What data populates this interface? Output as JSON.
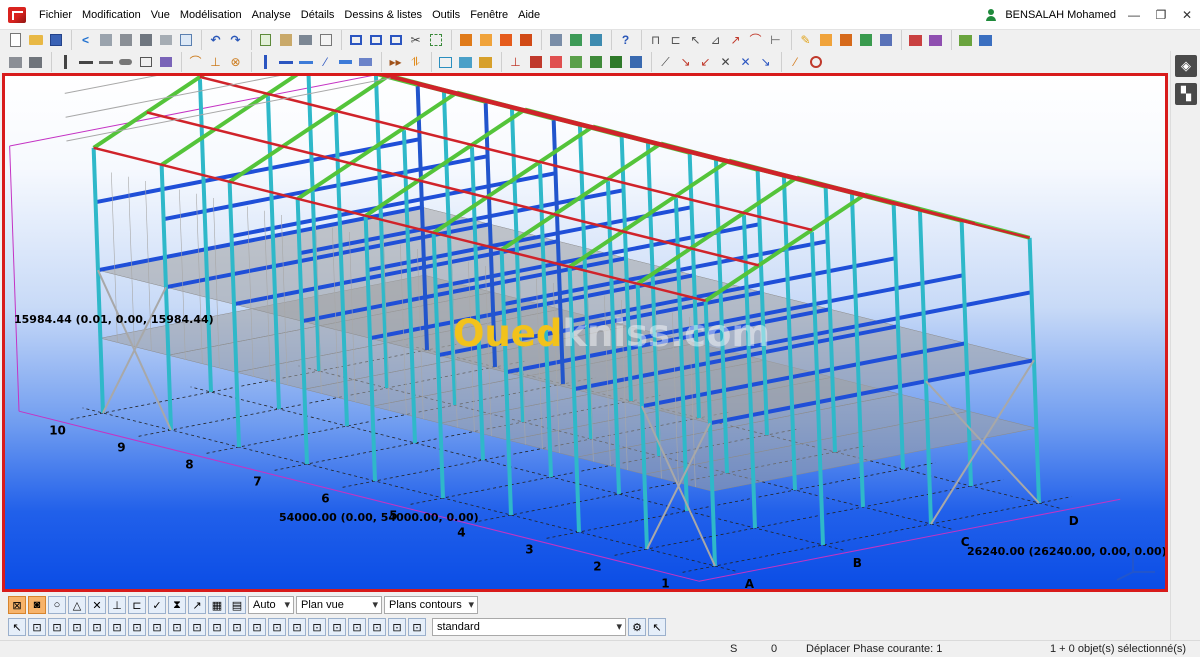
{
  "menu": {
    "items": [
      "Fichier",
      "Modification",
      "Vue",
      "Modélisation",
      "Analyse",
      "Détails",
      "Dessins & listes",
      "Outils",
      "Fenêtre",
      "Aide"
    ]
  },
  "user": {
    "name": "BENSALAH Mohamed"
  },
  "window_controls": {
    "minimize": "—",
    "restore": "❐",
    "close": "✕"
  },
  "viewport": {
    "watermark": {
      "part1": "Oued",
      "part2": "kniss.com"
    },
    "dimensions": {
      "height": "15984.44 (0.01, 0.00, 15984.44)",
      "length": "54000.00 (0.00, 54000.00, 0.00)",
      "width": "26240.00 (26240.00, 0.00, 0.00)"
    },
    "grid_labels_front": [
      "1",
      "2",
      "3",
      "4",
      "5",
      "6",
      "7",
      "8",
      "9",
      "10"
    ],
    "grid_labels_side": [
      "A",
      "B",
      "C",
      "D"
    ],
    "colors": {
      "purlins": "#d0232a",
      "rafters": "#54c43a",
      "columns": "#2fb8c9",
      "beams": "#1f4fd8",
      "slab": "#a0a0a0",
      "frame": "#a8a8a8"
    }
  },
  "bottom_toolbar": {
    "selects": {
      "auto": "Auto",
      "view": "Plan vue",
      "contours": "Plans contours"
    },
    "filter": "standard"
  },
  "statusbar": {
    "s": "S",
    "zero": "0",
    "message": "Déplacer Phase courante: 1",
    "selection": "1 + 0 objet(s) sélectionné(s)"
  }
}
